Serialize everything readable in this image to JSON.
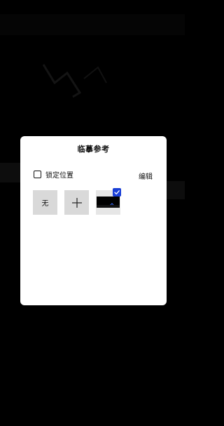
{
  "dialog": {
    "title": "临摹参考",
    "lock_label": "锁定位置",
    "lock_checked": false,
    "edit_label": "编辑",
    "thumbnails": [
      {
        "label": "无",
        "type": "none",
        "selected": false
      },
      {
        "label": "",
        "type": "add",
        "icon": "plus-icon",
        "selected": false
      },
      {
        "label": "",
        "type": "image",
        "selected": true,
        "badge_color": "#1a3fd6"
      }
    ]
  },
  "colors": {
    "overlay": "#000000",
    "dialog_bg": "#ffffff",
    "thumb_bg": "#d9d9d9",
    "accent": "#1a3fd6"
  }
}
